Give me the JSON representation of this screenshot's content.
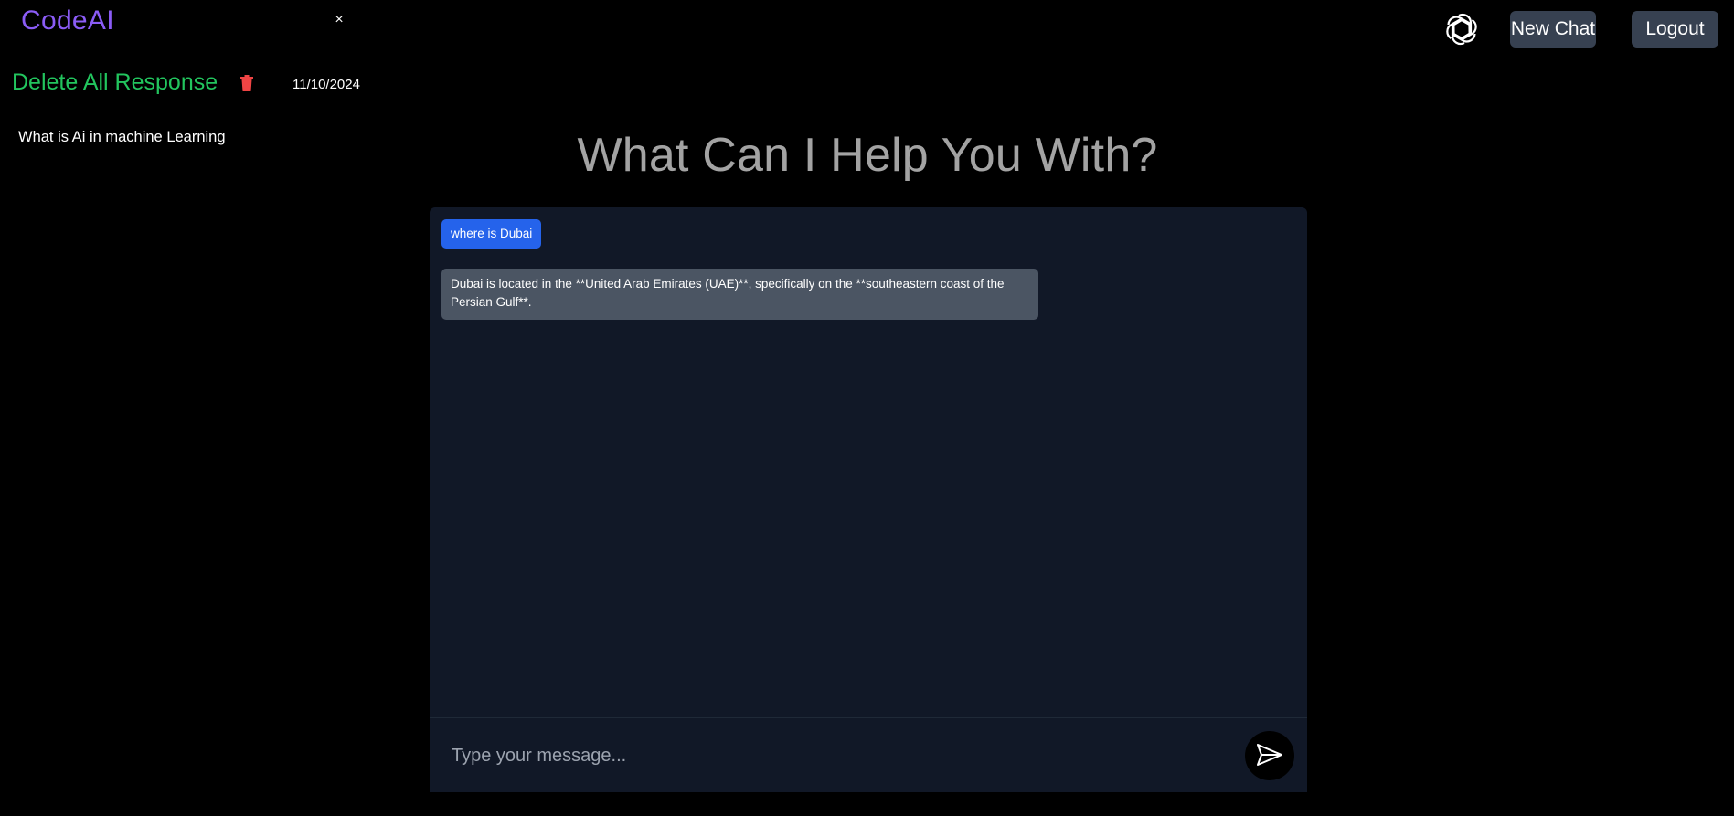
{
  "sidebar": {
    "brand": "CodeAI",
    "close_label": "×",
    "delete_all_label": "Delete All Response",
    "date": "11/10/2024",
    "history": [
      {
        "label": "What is Ai in machine Learning"
      }
    ]
  },
  "nav": {
    "new_chat_label": "New Chat",
    "logout_label": "Logout"
  },
  "main": {
    "heading": "What Can I Help You With?"
  },
  "chat": {
    "messages": [
      {
        "role": "user",
        "text": "where is Dubai"
      },
      {
        "role": "assistant",
        "text": "Dubai is located in the **United Arab Emirates (UAE)**, specifically on the **southeastern coast of the Persian Gulf**."
      }
    ],
    "input_placeholder": "Type your message...",
    "input_value": ""
  },
  "colors": {
    "brand": "#8b5cf6",
    "delete": "#22c55e",
    "trash": "#ef4444",
    "user_bubble": "#2563eb",
    "bot_bubble": "#4b5563",
    "panel": "#111827",
    "button": "#374151"
  },
  "icons": {
    "trash": "trash-icon",
    "logo": "openai-logo-icon",
    "send": "send-icon"
  }
}
